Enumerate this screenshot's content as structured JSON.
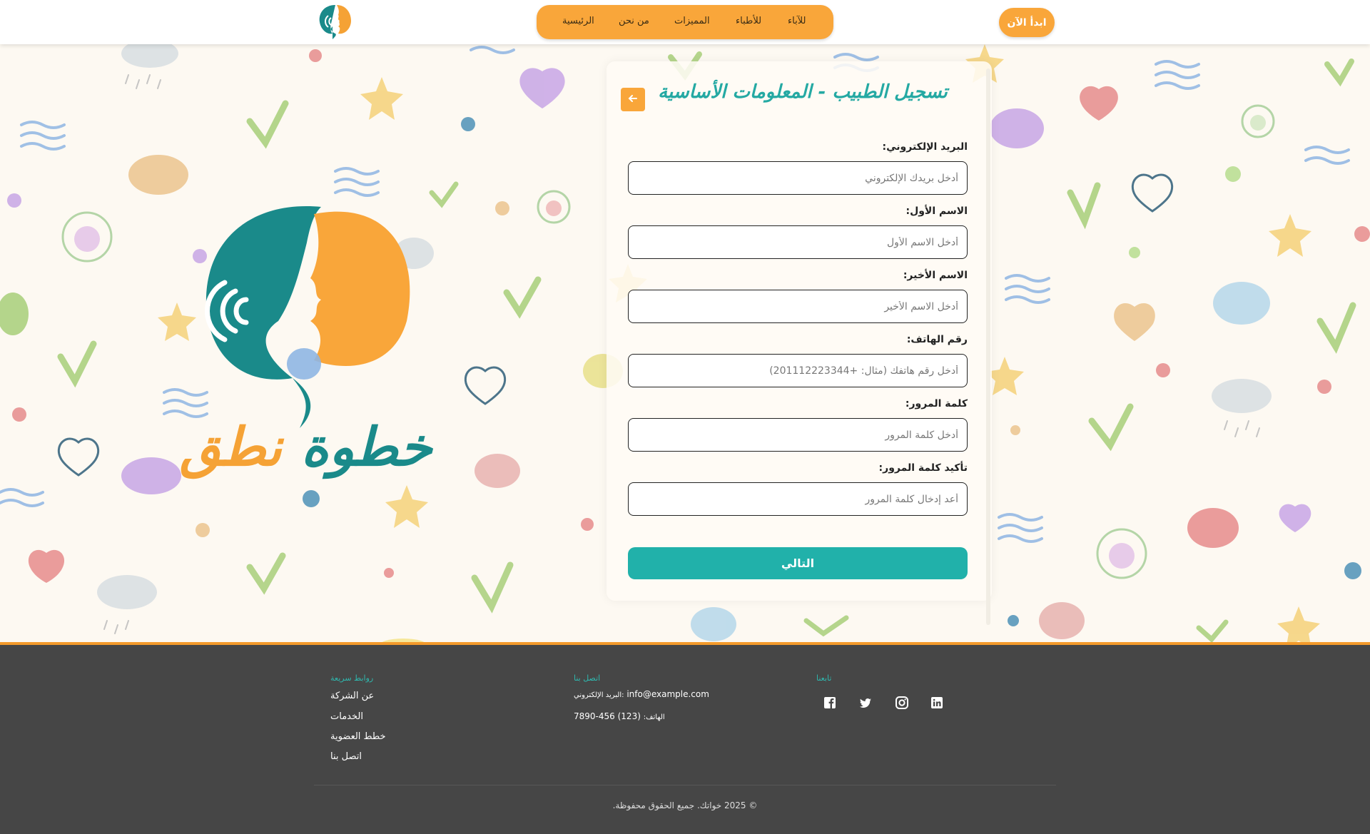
{
  "header": {
    "cta_label": "ابدأ الآن",
    "nav": [
      "للآباء",
      "للأطباء",
      "المميزات",
      "من نحن",
      "الرئيسية"
    ]
  },
  "logo": {
    "word1": "خطوة",
    "word2": "نطق"
  },
  "form": {
    "back_icon": "arrow-left-icon",
    "title": "تسجيل الطبيب - المعلومات الأساسية",
    "fields": [
      {
        "label": "البريد الإلكتروني:",
        "placeholder": "أدخل بريدك الإلكتروني",
        "value": ""
      },
      {
        "label": "الاسم الأول:",
        "placeholder": "أدخل الاسم الأول",
        "value": ""
      },
      {
        "label": "الاسم الأخير:",
        "placeholder": "أدخل الاسم الأخير",
        "value": ""
      },
      {
        "label": "رقم الهاتف:",
        "placeholder": "أدخل رقم هاتفك (مثال: +201112223344)",
        "value": ""
      },
      {
        "label": "كلمة المرور:",
        "placeholder": "أدخل كلمة المرور",
        "value": ""
      },
      {
        "label": "تأكيد كلمة المرور:",
        "placeholder": "أعد إدخال كلمة المرور",
        "value": ""
      }
    ],
    "submit_label": "التالي"
  },
  "footer": {
    "links_heading": "روابط سريعة",
    "links": [
      "عن الشركة",
      "الخدمات",
      "خطط العضوية",
      "اتصل بنا"
    ],
    "contact_heading": "اتصل بنا",
    "email_label": "البريد الإلكتروني:",
    "email": "info@example.com",
    "phone_label": "الهاتف:",
    "phone": "(123) 456-7890",
    "social_heading": "تابعنا",
    "social_icons": [
      "facebook-icon",
      "twitter-icon",
      "instagram-icon",
      "linkedin-icon"
    ],
    "copyright": "© 2025 خواتك. جميع الحقوق محفوظة."
  },
  "colors": {
    "orange": "#f9a63a",
    "teal": "#21b1aa",
    "footer_bg": "#464646",
    "page_bg": "#fdf9f2"
  }
}
